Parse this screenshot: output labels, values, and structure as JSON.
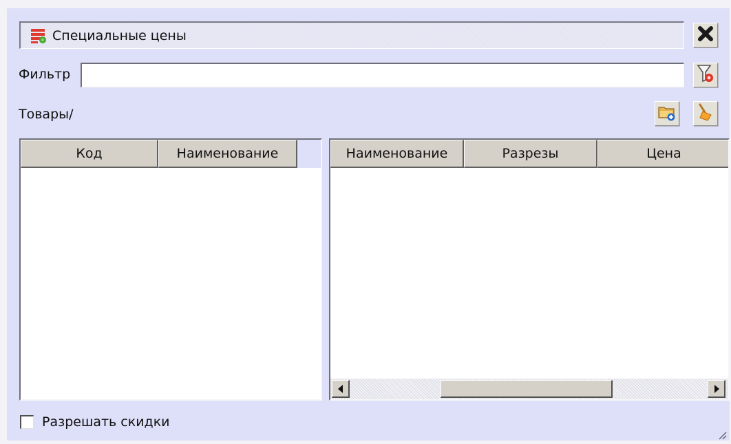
{
  "window": {
    "title": "Специальные цены",
    "title_icon": "special-prices-icon",
    "close_icon": "close-x-icon"
  },
  "filter": {
    "label": "Фильтр",
    "value": "",
    "placeholder": "",
    "clear_icon": "filter-clear-icon"
  },
  "path": {
    "label": "Товары/"
  },
  "toolbar": {
    "add_icon": "add-folder-icon",
    "clean_icon": "broom-icon"
  },
  "left_grid": {
    "columns": [
      "Код",
      "Наименование"
    ],
    "rows": []
  },
  "right_grid": {
    "columns": [
      "Наименование",
      "Разрезы",
      "Цена"
    ],
    "rows": []
  },
  "options": {
    "allow_discounts_label": "Разрешать скидки",
    "allow_discounts_checked": false
  },
  "colors": {
    "window_bg": "#dedff8",
    "header_bg": "#d5d0c8",
    "grid_bg": "#ffffff"
  }
}
